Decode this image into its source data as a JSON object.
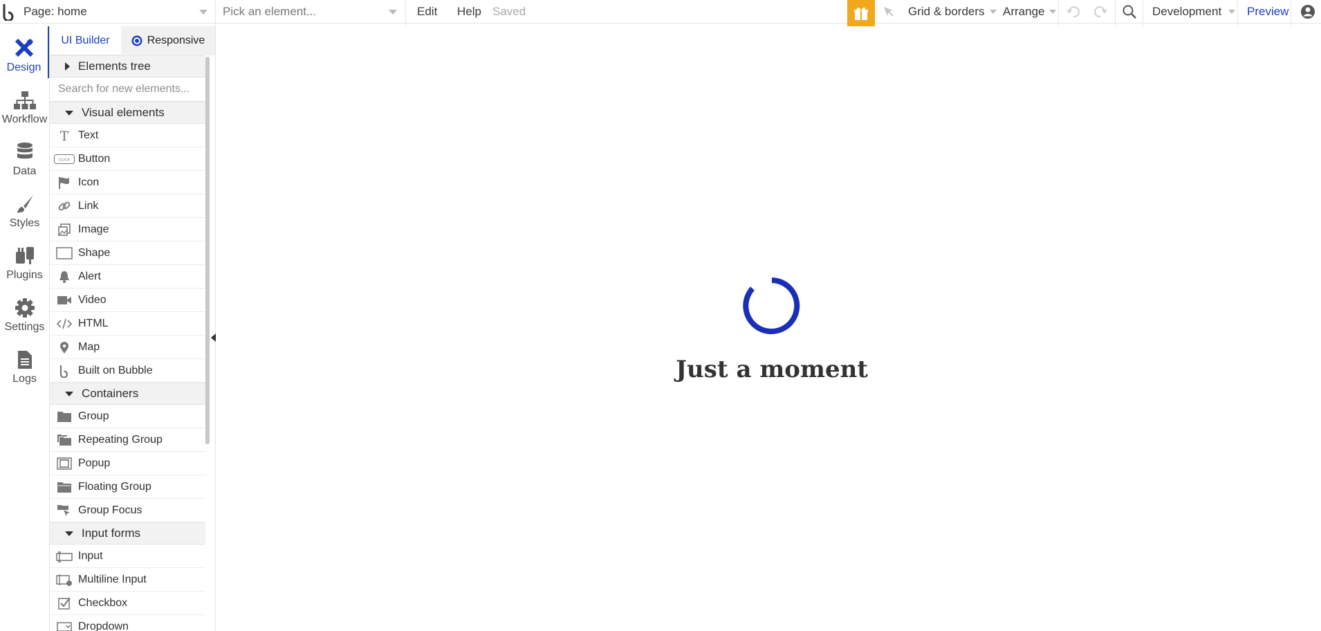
{
  "topbar": {
    "page_selector": "Page: home",
    "element_picker_placeholder": "Pick an element...",
    "edit": "Edit",
    "help": "Help",
    "save_status": "Saved",
    "grid_borders": "Grid & borders",
    "arrange": "Arrange",
    "environment": "Development",
    "preview": "Preview"
  },
  "rail": {
    "items": [
      {
        "label": "Design",
        "icon": "design-icon"
      },
      {
        "label": "Workflow",
        "icon": "workflow-icon"
      },
      {
        "label": "Data",
        "icon": "database-icon"
      },
      {
        "label": "Styles",
        "icon": "brush-icon"
      },
      {
        "label": "Plugins",
        "icon": "plug-icon"
      },
      {
        "label": "Settings",
        "icon": "gear-icon"
      },
      {
        "label": "Logs",
        "icon": "document-icon"
      }
    ]
  },
  "panel": {
    "tab_ui_builder": "UI Builder",
    "tab_responsive": "Responsive",
    "elements_tree": "Elements tree",
    "search_placeholder": "Search for new elements...",
    "visual_heading": "Visual elements",
    "visual_items": [
      "Text",
      "Button",
      "Icon",
      "Link",
      "Image",
      "Shape",
      "Alert",
      "Video",
      "HTML",
      "Map",
      "Built on Bubble"
    ],
    "containers_heading": "Containers",
    "container_items": [
      "Group",
      "Repeating Group",
      "Popup",
      "Floating Group",
      "Group Focus"
    ],
    "input_heading": "Input forms",
    "input_items": [
      "Input",
      "Multiline Input",
      "Checkbox",
      "Dropdown"
    ]
  },
  "canvas": {
    "loading_text": "Just a moment"
  },
  "colors": {
    "accent": "#1c3fc1",
    "gift": "#f2a81d",
    "spinner": "#1a2fb8"
  }
}
